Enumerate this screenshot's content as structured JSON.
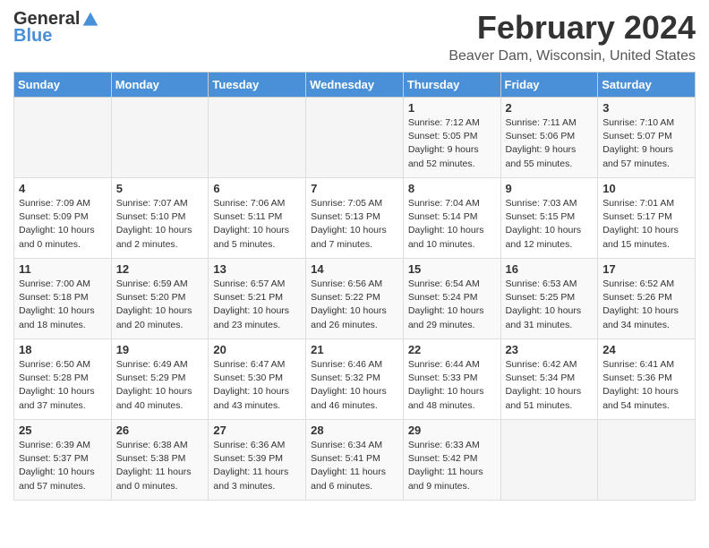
{
  "header": {
    "logo_general": "General",
    "logo_blue": "Blue",
    "title": "February 2024",
    "location": "Beaver Dam, Wisconsin, United States"
  },
  "weekdays": [
    "Sunday",
    "Monday",
    "Tuesday",
    "Wednesday",
    "Thursday",
    "Friday",
    "Saturday"
  ],
  "weeks": [
    [
      {
        "day": "",
        "info": ""
      },
      {
        "day": "",
        "info": ""
      },
      {
        "day": "",
        "info": ""
      },
      {
        "day": "",
        "info": ""
      },
      {
        "day": "1",
        "info": "Sunrise: 7:12 AM\nSunset: 5:05 PM\nDaylight: 9 hours\nand 52 minutes."
      },
      {
        "day": "2",
        "info": "Sunrise: 7:11 AM\nSunset: 5:06 PM\nDaylight: 9 hours\nand 55 minutes."
      },
      {
        "day": "3",
        "info": "Sunrise: 7:10 AM\nSunset: 5:07 PM\nDaylight: 9 hours\nand 57 minutes."
      }
    ],
    [
      {
        "day": "4",
        "info": "Sunrise: 7:09 AM\nSunset: 5:09 PM\nDaylight: 10 hours\nand 0 minutes."
      },
      {
        "day": "5",
        "info": "Sunrise: 7:07 AM\nSunset: 5:10 PM\nDaylight: 10 hours\nand 2 minutes."
      },
      {
        "day": "6",
        "info": "Sunrise: 7:06 AM\nSunset: 5:11 PM\nDaylight: 10 hours\nand 5 minutes."
      },
      {
        "day": "7",
        "info": "Sunrise: 7:05 AM\nSunset: 5:13 PM\nDaylight: 10 hours\nand 7 minutes."
      },
      {
        "day": "8",
        "info": "Sunrise: 7:04 AM\nSunset: 5:14 PM\nDaylight: 10 hours\nand 10 minutes."
      },
      {
        "day": "9",
        "info": "Sunrise: 7:03 AM\nSunset: 5:15 PM\nDaylight: 10 hours\nand 12 minutes."
      },
      {
        "day": "10",
        "info": "Sunrise: 7:01 AM\nSunset: 5:17 PM\nDaylight: 10 hours\nand 15 minutes."
      }
    ],
    [
      {
        "day": "11",
        "info": "Sunrise: 7:00 AM\nSunset: 5:18 PM\nDaylight: 10 hours\nand 18 minutes."
      },
      {
        "day": "12",
        "info": "Sunrise: 6:59 AM\nSunset: 5:20 PM\nDaylight: 10 hours\nand 20 minutes."
      },
      {
        "day": "13",
        "info": "Sunrise: 6:57 AM\nSunset: 5:21 PM\nDaylight: 10 hours\nand 23 minutes."
      },
      {
        "day": "14",
        "info": "Sunrise: 6:56 AM\nSunset: 5:22 PM\nDaylight: 10 hours\nand 26 minutes."
      },
      {
        "day": "15",
        "info": "Sunrise: 6:54 AM\nSunset: 5:24 PM\nDaylight: 10 hours\nand 29 minutes."
      },
      {
        "day": "16",
        "info": "Sunrise: 6:53 AM\nSunset: 5:25 PM\nDaylight: 10 hours\nand 31 minutes."
      },
      {
        "day": "17",
        "info": "Sunrise: 6:52 AM\nSunset: 5:26 PM\nDaylight: 10 hours\nand 34 minutes."
      }
    ],
    [
      {
        "day": "18",
        "info": "Sunrise: 6:50 AM\nSunset: 5:28 PM\nDaylight: 10 hours\nand 37 minutes."
      },
      {
        "day": "19",
        "info": "Sunrise: 6:49 AM\nSunset: 5:29 PM\nDaylight: 10 hours\nand 40 minutes."
      },
      {
        "day": "20",
        "info": "Sunrise: 6:47 AM\nSunset: 5:30 PM\nDaylight: 10 hours\nand 43 minutes."
      },
      {
        "day": "21",
        "info": "Sunrise: 6:46 AM\nSunset: 5:32 PM\nDaylight: 10 hours\nand 46 minutes."
      },
      {
        "day": "22",
        "info": "Sunrise: 6:44 AM\nSunset: 5:33 PM\nDaylight: 10 hours\nand 48 minutes."
      },
      {
        "day": "23",
        "info": "Sunrise: 6:42 AM\nSunset: 5:34 PM\nDaylight: 10 hours\nand 51 minutes."
      },
      {
        "day": "24",
        "info": "Sunrise: 6:41 AM\nSunset: 5:36 PM\nDaylight: 10 hours\nand 54 minutes."
      }
    ],
    [
      {
        "day": "25",
        "info": "Sunrise: 6:39 AM\nSunset: 5:37 PM\nDaylight: 10 hours\nand 57 minutes."
      },
      {
        "day": "26",
        "info": "Sunrise: 6:38 AM\nSunset: 5:38 PM\nDaylight: 11 hours\nand 0 minutes."
      },
      {
        "day": "27",
        "info": "Sunrise: 6:36 AM\nSunset: 5:39 PM\nDaylight: 11 hours\nand 3 minutes."
      },
      {
        "day": "28",
        "info": "Sunrise: 6:34 AM\nSunset: 5:41 PM\nDaylight: 11 hours\nand 6 minutes."
      },
      {
        "day": "29",
        "info": "Sunrise: 6:33 AM\nSunset: 5:42 PM\nDaylight: 11 hours\nand 9 minutes."
      },
      {
        "day": "",
        "info": ""
      },
      {
        "day": "",
        "info": ""
      }
    ]
  ]
}
